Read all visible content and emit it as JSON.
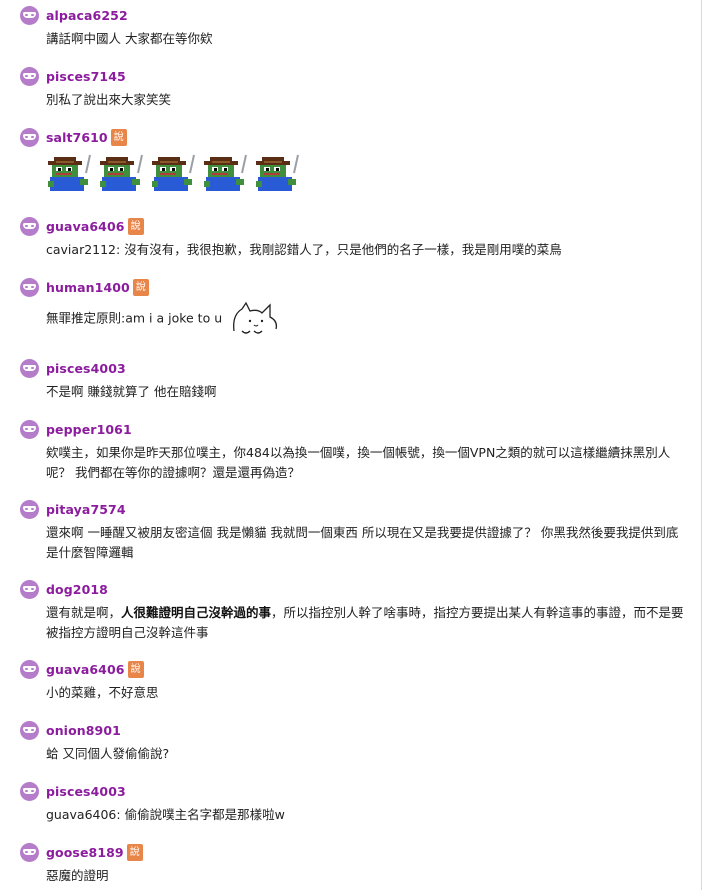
{
  "comments": [
    {
      "user": "alpaca6252",
      "badge": "",
      "text": "講話啊中國人 大家都在等你欸"
    },
    {
      "user": "pisces7145",
      "badge": "",
      "text": "別私了說出來大家笑笑"
    },
    {
      "user": "salt7610",
      "badge": "說",
      "text": ""
    },
    {
      "user": "guava6406",
      "badge": "說",
      "text": "caviar2112: 沒有沒有，我很抱歉，我剛認錯人了，只是他們的名子一樣，我是剛用噗的菜鳥"
    },
    {
      "user": "human1400",
      "badge": "說",
      "text": "無罪推定原則:am i a joke to u"
    },
    {
      "user": "pisces4003",
      "badge": "",
      "text": "不是啊 賺錢就算了 他在賠錢啊"
    },
    {
      "user": "pepper1061",
      "badge": "",
      "text": "欸噗主，如果你是昨天那位噗主，你484以為換一個噗，換一個帳號，換一個VPN之類的就可以這樣繼續抹黑別人呢？ 我們都在等你的證據啊？還是還再偽造？"
    },
    {
      "user": "pitaya7574",
      "badge": "",
      "text": "還來啊 一睡醒又被朋友密這個 我是懶貓 我就問一個東西 所以現在又是我要提供證據了？ 你黑我然後要我提供到底是什麼智障邏輯"
    },
    {
      "user": "dog2018",
      "badge": "",
      "text_pre": "還有就是啊，",
      "text_bold": "人很難證明自己沒幹過的事",
      "text_post": "，所以指控別人幹了啥事時，指控方要提出某人有幹這事的事證，而不是要被指控方證明自己沒幹這件事"
    },
    {
      "user": "guava6406",
      "badge": "說",
      "text": "小的菜雞，不好意思"
    },
    {
      "user": "onion8901",
      "badge": "",
      "text": "蛤 又同個人發偷偷說?"
    },
    {
      "user": "pisces4003",
      "badge": "",
      "text": "guava6406: 偷偷說噗主名字都是那樣啦w"
    },
    {
      "user": "goose8189",
      "badge": "說",
      "text": "惡魔的證明"
    }
  ],
  "sticker_count": 5
}
